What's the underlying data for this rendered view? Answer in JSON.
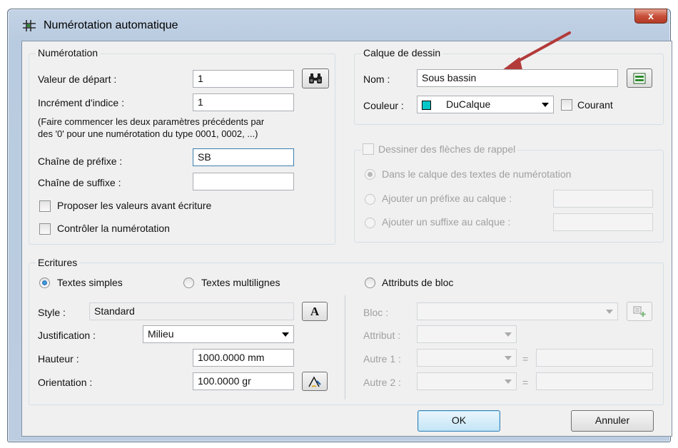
{
  "dialog": {
    "title": "Numérotation automatique",
    "close_label": "x"
  },
  "numerotation": {
    "group_label": "Numérotation",
    "start_value_label": "Valeur de départ :",
    "start_value": "1",
    "increment_label": "Incrément d'indice :",
    "increment_value": "1",
    "hint_line1": "(Faire commencer les deux paramètres précédents par",
    "hint_line2": "des '0' pour une numérotation du type 0001, 0002, ...)",
    "prefix_label": "Chaîne de préfixe :",
    "prefix_value": "SB",
    "suffix_label": "Chaîne de suffixe :",
    "suffix_value": "",
    "propose_label": "Proposer les valeurs avant écriture",
    "control_label": "Contrôler la numérotation"
  },
  "calque": {
    "group_label": "Calque de dessin",
    "name_label": "Nom :",
    "name_value": "Sous bassin",
    "color_label": "Couleur :",
    "color_value": "DuCalque",
    "color_swatch": "#00c8c8",
    "courant_label": "Courant"
  },
  "rappel": {
    "group_label": "Dessiner des flèches de rappel",
    "option_same_layer": "Dans le calque des textes de numérotation",
    "option_prefix": "Ajouter un préfixe au calque :",
    "option_suffix": "Ajouter un suffixe au calque :"
  },
  "ecritures": {
    "group_label": "Ecritures",
    "simple_label": "Textes simples",
    "multi_label": "Textes multilignes",
    "block_label": "Attributs de bloc",
    "style_label": "Style :",
    "style_value": "Standard",
    "justif_label": "Justification :",
    "justif_value": "Milieu",
    "hauteur_label": "Hauteur :",
    "hauteur_value": "1000.0000 mm",
    "orientation_label": "Orientation :",
    "orientation_value": "100.0000 gr",
    "bloc_label": "Bloc :",
    "attribut_label": "Attribut :",
    "autre1_label": "Autre 1 :",
    "autre2_label": "Autre 2 :",
    "equals": "="
  },
  "buttons": {
    "ok": "OK",
    "cancel": "Annuler",
    "font_glyph": "A"
  },
  "colors": {
    "arrow": "#b33a3a",
    "accent": "#3c7fb1"
  }
}
